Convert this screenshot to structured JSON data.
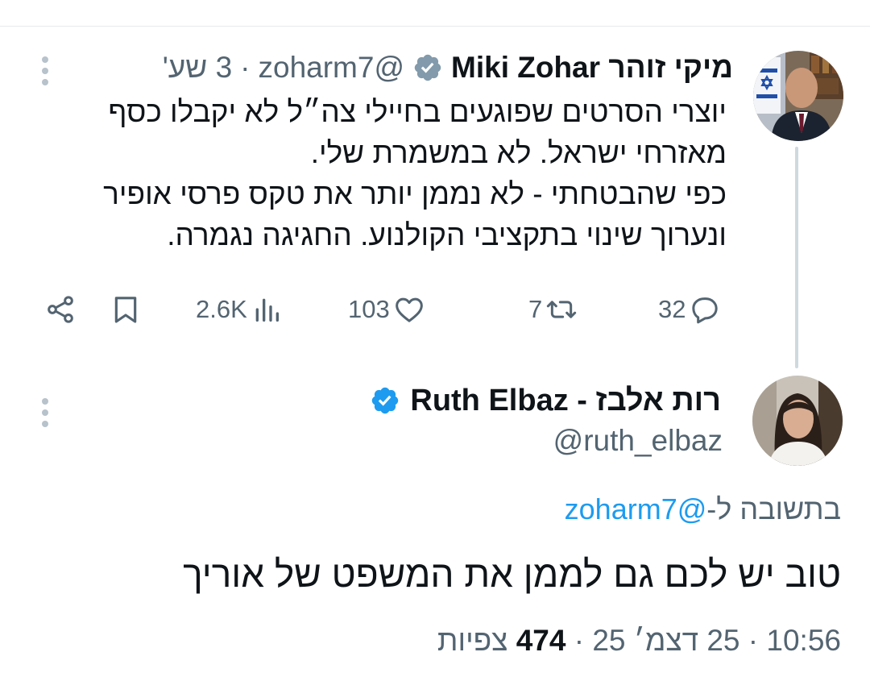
{
  "colors": {
    "accent": "#1d9bf0",
    "muted": "#536471",
    "text": "#0f1419",
    "thread_line": "#cfd9de"
  },
  "tweet": {
    "author_name": "מיקי זוהר Miki Zohar",
    "handle": "@zoharm7",
    "time": "3 שע'",
    "verified_icon": "verified-badge-icon",
    "body_lines": [
      "יוצרי הסרטים שפוגעים בחיילי צה״ל לא יקבלו כסף",
      "מאזרחי ישראל. לא במשמרת שלי.",
      "כפי שהבטחתי - לא נממן יותר את טקס פרסי אופיר",
      "ונערוך שינוי בתקציבי הקולנוע. החגיגה נגמרה."
    ],
    "actions": {
      "replies": "32",
      "retweets": "7",
      "likes": "103",
      "views": "2.6K"
    }
  },
  "reply": {
    "author_name": "רות אלבז - Ruth Elbaz",
    "handle": "@ruth_elbaz",
    "reply_to_prefix": "בתשובה ל-",
    "reply_to_handle": "@zoharm7",
    "text": "טוב יש לכם גם לממן את המשפט של אוריך",
    "time": "10:56",
    "date": "25 דצמ׳ 25",
    "views_count": "474",
    "views_label": "צפיות"
  }
}
